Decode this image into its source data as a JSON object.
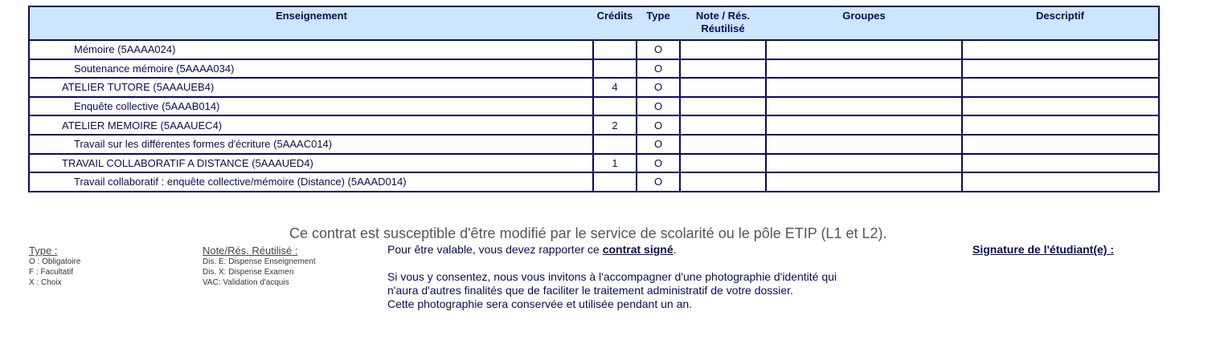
{
  "table": {
    "headers": {
      "enseignement": "Enseignement",
      "credits": "Crédits",
      "type": "Type",
      "note_line1": "Note / Rés.",
      "note_line2": "Réutilisé",
      "groupes": "Groupes",
      "descriptif": "Descriptif"
    },
    "rows": [
      {
        "label": "Mémoire (5AAAA024)",
        "credits": "",
        "type": "O"
      },
      {
        "label": "Soutenance mémoire (5AAAA034)",
        "credits": "",
        "type": "O"
      },
      {
        "label": "ATELIER TUTORE (5AAAUEB4)",
        "credits": "4",
        "type": "O"
      },
      {
        "label": "Enquête collective (5AAAB014)",
        "credits": "",
        "type": "O"
      },
      {
        "label": "ATELIER MEMOIRE (5AAAUEC4)",
        "credits": "2",
        "type": "O"
      },
      {
        "label": "Travail sur les différentes formes d'écriture (5AAAC014)",
        "credits": "",
        "type": "O"
      },
      {
        "label": "TRAVAIL COLLABORATIF A DISTANCE (5AAAUED4)",
        "credits": "1",
        "type": "O"
      },
      {
        "label": "Travail collaboratif : enquête collective/mémoire (Distance) (5AAAD014)",
        "credits": "",
        "type": "O"
      }
    ]
  },
  "notice": "Ce contrat est susceptible d'être modifié par le service de scolarité ou le pôle ETIP (L1 et L2).",
  "legend_type": {
    "title": "Type :",
    "items": [
      "O : Obligatoire",
      "F : Facultatif",
      "X : Choix"
    ]
  },
  "legend_note": {
    "title": "Note/Rés. Réutilisé :",
    "items": [
      "Dis. E: Dispense Enseignement",
      "Dis. X: Dispense Examen",
      "VAC: Validation d'acquis"
    ]
  },
  "info": {
    "line1_prefix": "Pour être valable, vous devez rapporter ce ",
    "line1_bold": "contrat signé",
    "line1_suffix": ".",
    "para2_line1": "Si vous y consentez, nous vous invitons à l'accompagner d'une photographie d'identité qui",
    "para2_line2": "n'aura d'autres finalités que de faciliter le traitement administratif de votre dossier.",
    "para2_line3": "Cette photographie sera conservée et utilisée pendant un an."
  },
  "signature_label": "Signature de l'étudiant(e) :"
}
